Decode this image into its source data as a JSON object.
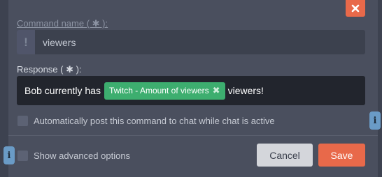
{
  "dialog": {
    "command_name_label": "Command name ( ✱ ):",
    "command_prefix": "!",
    "command_name_value": "viewers",
    "response_label": "Response ( ✱ ):",
    "response_before": "Bob currently has",
    "response_tag": "Twitch - Amount of viewers",
    "response_after": "viewers!",
    "auto_post_label": "Automatically post this command to chat while chat is active",
    "advanced_label": "Show advanced options",
    "cancel_label": "Cancel",
    "save_label": "Save",
    "info_glyph": "i",
    "tag_remove_glyph": "✖"
  },
  "colors": {
    "accent": "#e8694a",
    "tag_green": "#3dae6f",
    "info_blue": "#6a9bc6"
  },
  "icons": [
    "close-icon",
    "exclamation-icon",
    "tag-remove-icon",
    "info-icon"
  ]
}
